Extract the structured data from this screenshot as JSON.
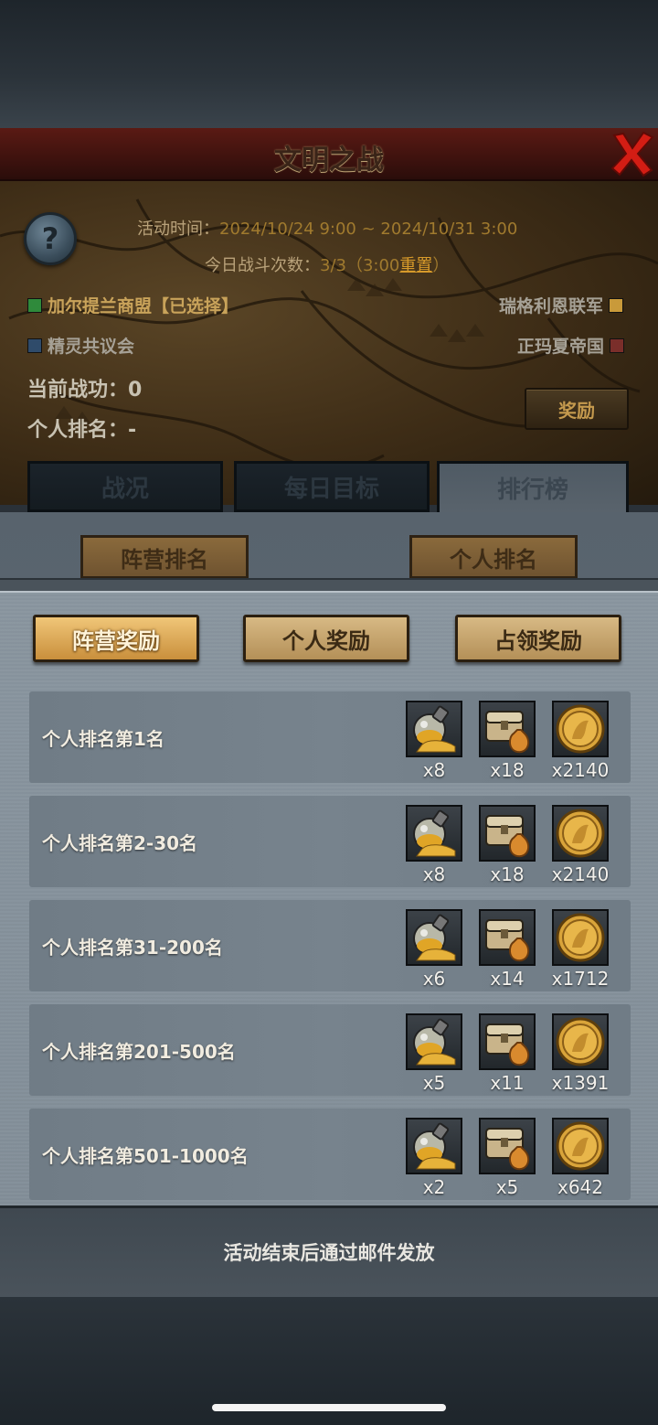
{
  "header": {
    "title": "文明之战"
  },
  "event": {
    "time_label": "活动时间：",
    "time_value": "2024/10/24 9:00 ~ 2024/10/31 3:00",
    "battle_label": "今日战斗次数：",
    "battle_value": "3/3（3:00",
    "battle_reset": "重置",
    "battle_close": "）"
  },
  "factions": [
    {
      "name": "加尔提兰商盟【已选择】",
      "color": "#2f8a3b"
    },
    {
      "name": "精灵共议会",
      "color": "#2f4b6a"
    },
    {
      "name": "瑞格利恩联军",
      "color": "#c99a3a"
    },
    {
      "name": "正玛夏帝国",
      "color": "#7a2e2a"
    }
  ],
  "stats": {
    "merit": "当前战功：0",
    "rank": "个人排名：-"
  },
  "reward_button": "奖励",
  "tabs": [
    "战况",
    "每日目标",
    "排行榜"
  ],
  "subtabs": [
    "阵营排名",
    "个人排名"
  ],
  "reward_tabs": [
    "阵营奖励",
    "个人奖励",
    "占领奖励"
  ],
  "rewards": [
    {
      "label": "个人排名第1名",
      "items": [
        "x8",
        "x18",
        "x2140"
      ]
    },
    {
      "label": "个人排名第2-30名",
      "items": [
        "x8",
        "x18",
        "x2140"
      ]
    },
    {
      "label": "个人排名第31-200名",
      "items": [
        "x6",
        "x14",
        "x1712"
      ]
    },
    {
      "label": "个人排名第201-500名",
      "items": [
        "x5",
        "x11",
        "x1391"
      ]
    },
    {
      "label": "个人排名第501-1000名",
      "items": [
        "x2",
        "x5",
        "x642"
      ]
    }
  ],
  "item_icons": [
    "gold-potion-icon",
    "treasure-chest-icon",
    "gold-coin-icon"
  ],
  "footer": "活动结束后通过邮件发放"
}
